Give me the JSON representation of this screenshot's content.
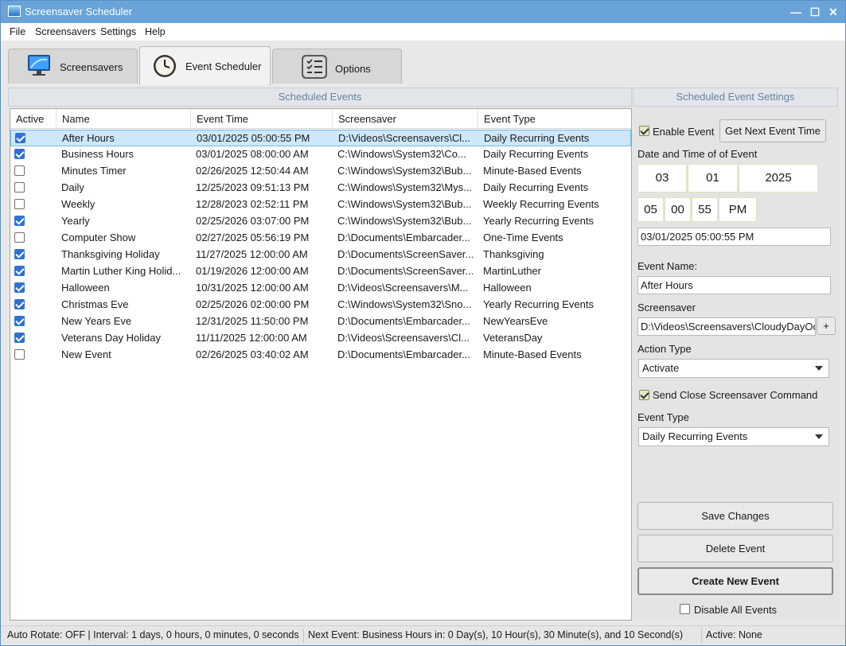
{
  "window": {
    "title": "Screensaver Scheduler",
    "controls": {
      "minimize": "—",
      "maximize": "☐",
      "close": "✕"
    }
  },
  "menu": [
    "File",
    "Screensavers",
    "Settings",
    "Help"
  ],
  "tabs": [
    {
      "label": "Screensavers",
      "icon": "monitor-icon"
    },
    {
      "label": "Event Scheduler",
      "icon": "clock-icon"
    },
    {
      "label": "Options",
      "icon": "checklist-icon"
    }
  ],
  "scheduled_events": {
    "title": "Scheduled Events",
    "columns": [
      "Active",
      "Name",
      "Event Time",
      "Screensaver",
      "Event Type"
    ],
    "rows": [
      {
        "active": true,
        "name": "After Hours",
        "time": "03/01/2025 05:00:55 PM",
        "screensaver": "D:\\Videos\\Screensavers\\Cl...",
        "type": "Daily Recurring Events"
      },
      {
        "active": true,
        "name": "Business Hours",
        "time": "03/01/2025 08:00:00 AM",
        "screensaver": "C:\\Windows\\System32\\Co...",
        "type": "Daily Recurring Events"
      },
      {
        "active": false,
        "name": "Minutes Timer",
        "time": "02/26/2025 12:50:44 AM",
        "screensaver": "C:\\Windows\\System32\\Bub...",
        "type": "Minute-Based Events"
      },
      {
        "active": false,
        "name": "Daily",
        "time": "12/25/2023 09:51:13 PM",
        "screensaver": "C:\\Windows\\System32\\Mys...",
        "type": "Daily Recurring Events"
      },
      {
        "active": false,
        "name": "Weekly",
        "time": "12/28/2023 02:52:11 PM",
        "screensaver": "C:\\Windows\\System32\\Bub...",
        "type": "Weekly Recurring Events"
      },
      {
        "active": true,
        "name": "Yearly",
        "time": "02/25/2026 03:07:00 PM",
        "screensaver": "C:\\Windows\\System32\\Bub...",
        "type": "Yearly Recurring Events"
      },
      {
        "active": false,
        "name": "Computer Show",
        "time": "02/27/2025 05:56:19 PM",
        "screensaver": "D:\\Documents\\Embarcader...",
        "type": "One-Time Events"
      },
      {
        "active": true,
        "name": "Thanksgiving Holiday",
        "time": "11/27/2025 12:00:00 AM",
        "screensaver": "D:\\Documents\\ScreenSaver...",
        "type": "Thanksgiving"
      },
      {
        "active": true,
        "name": "Martin Luther King Holid...",
        "time": "01/19/2026 12:00:00 AM",
        "screensaver": "D:\\Documents\\ScreenSaver...",
        "type": "MartinLuther"
      },
      {
        "active": true,
        "name": "Halloween",
        "time": "10/31/2025 12:00:00 AM",
        "screensaver": "D:\\Videos\\Screensavers\\M...",
        "type": "Halloween"
      },
      {
        "active": true,
        "name": "Christmas Eve",
        "time": "02/25/2026 02:00:00 PM",
        "screensaver": "C:\\Windows\\System32\\Sno...",
        "type": "Yearly Recurring Events"
      },
      {
        "active": true,
        "name": "New Years Eve",
        "time": "12/31/2025 11:50:00 PM",
        "screensaver": "D:\\Documents\\Embarcader...",
        "type": "NewYearsEve"
      },
      {
        "active": true,
        "name": "Veterans Day Holiday",
        "time": "11/11/2025 12:00:00 AM",
        "screensaver": "D:\\Videos\\Screensavers\\Cl...",
        "type": "VeteransDay"
      },
      {
        "active": false,
        "name": "New Event",
        "time": "02/26/2025 03:40:02 AM",
        "screensaver": "D:\\Documents\\Embarcader...",
        "type": "Minute-Based Events"
      }
    ]
  },
  "settings": {
    "title": "Scheduled Event Settings",
    "enable_event_label": "Enable Event",
    "enable_event_checked": true,
    "get_next_label": "Get Next Event Time",
    "date_time_label": "Date and Time of of Event",
    "date_month": "03",
    "date_day": "01",
    "date_year": "2025",
    "time_hour": "05",
    "time_minute": "00",
    "time_second": "55",
    "time_ampm": "PM",
    "datetime_value": "03/01/2025 05:00:55 PM",
    "event_name_label": "Event Name:",
    "event_name_value": "After Hours",
    "screensaver_label": "Screensaver",
    "screensaver_value": "D:\\Videos\\Screensavers\\CloudyDayOc",
    "browse_label": "+",
    "action_type_label": "Action Type",
    "action_type_value": "Activate",
    "send_close_label": "Send Close Screensaver Command",
    "send_close_checked": true,
    "event_type_label": "Event Type",
    "event_type_value": "Daily Recurring Events",
    "save_label": "Save Changes",
    "delete_label": "Delete Event",
    "create_label": "Create New Event",
    "disable_all_label": "Disable All Events",
    "disable_all_checked": false
  },
  "status": {
    "auto_rotate": "Auto Rotate: OFF | Interval: 1 days, 0 hours, 0 minutes, 0 seconds",
    "next_event": "Next Event: Business Hours in: 0 Day(s), 10 Hour(s), 30 Minute(s), and 10 Second(s)",
    "active": "Active: None"
  }
}
